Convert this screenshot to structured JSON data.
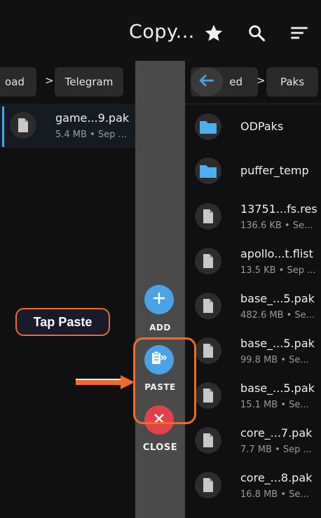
{
  "topbar": {
    "title": "Copy...",
    "icons": [
      "star-icon",
      "search-icon",
      "sort-icon"
    ]
  },
  "left_breadcrumb": {
    "crumbs": [
      "oad",
      "Telegram"
    ],
    "separator": ">"
  },
  "right_breadcrumb": {
    "back_icon": "arrow-left-icon",
    "crumbs": [
      "ed",
      "Paks"
    ],
    "separator": ">"
  },
  "left_files": [
    {
      "name": "game...9.pak",
      "meta": "5.4 MB • Sep ...",
      "type": "file",
      "selected": true
    }
  ],
  "right_files": [
    {
      "name": "ODPaks",
      "meta": "",
      "type": "folder"
    },
    {
      "name": "puffer_temp",
      "meta": "",
      "type": "folder"
    },
    {
      "name": "13751...fs.res",
      "meta": "136.6 KB • Se...",
      "type": "file"
    },
    {
      "name": "apollo...t.flist",
      "meta": "13.5 KB • Sep ...",
      "type": "file"
    },
    {
      "name": "base_...5.pak",
      "meta": "482.6 MB • Se...",
      "type": "file"
    },
    {
      "name": "base_...5.pak",
      "meta": "99.8 MB • Se...",
      "type": "file"
    },
    {
      "name": "base_...5.pak",
      "meta": "15.1 MB • Se...",
      "type": "file"
    },
    {
      "name": "core_...7.pak",
      "meta": "7.7 MB • Sep ...",
      "type": "file"
    },
    {
      "name": "core_...8.pak",
      "meta": "16.8 MB • Se...",
      "type": "file"
    }
  ],
  "actions": {
    "add": "ADD",
    "paste": "PASTE",
    "close": "CLOSE"
  },
  "annotation": {
    "callout": "Tap Paste"
  },
  "colors": {
    "accent_blue": "#49a3e6",
    "folder_blue": "#4ab0f0",
    "close_red": "#e0424a",
    "annotation_orange": "#f06a2a",
    "strip_gray": "#4a4a4a"
  }
}
